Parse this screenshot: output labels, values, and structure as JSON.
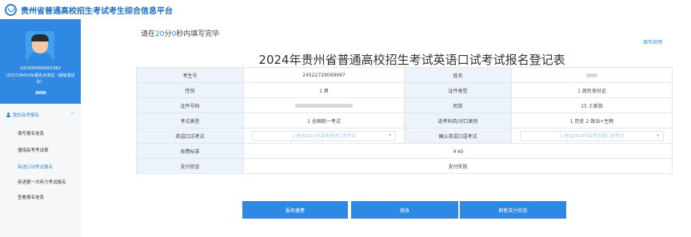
{
  "app": {
    "title": "贵州省普通高校招生考试考生综合信息平台",
    "logo_icon": "circle-logo-icon"
  },
  "sidebar": {
    "user_id": "2024000000001962",
    "user_desc": "(5227284109)报名点测试（首级测试办）",
    "menu_title": "我的高考报名",
    "menu_icon": "user-icon",
    "items": [
      {
        "label": "填写报名信息"
      },
      {
        "label": "僵饱高考考试费"
      },
      {
        "label": "英语口试考试报名"
      },
      {
        "label": "英语第一次听力考试报名"
      },
      {
        "label": "查看报名信息"
      }
    ],
    "active_index": 2
  },
  "timer": {
    "prefix": "请在",
    "minutes": "20",
    "min_unit": "分",
    "seconds": "0",
    "suffix": "秒内填写完毕"
  },
  "help_link": "填写说明",
  "form": {
    "title": "2024年贵州省普通高校招生考试英语口试考试报名登记表",
    "rows": [
      {
        "l1": "考生号",
        "v1": "24522729099997",
        "l2": "姓名",
        "v2": ""
      },
      {
        "l1": "性别",
        "v1": "1 男",
        "l2": "证件类型",
        "v2": "1 居民身份证"
      },
      {
        "l1": "证件号码",
        "v1": "",
        "l2": "民族",
        "v2": "15 土家族"
      },
      {
        "l1": "考试类型",
        "v1": "1 全国统一考试",
        "l2": "选考科目/对口类别",
        "v2": "1 历史 2 政治+生物"
      },
      {
        "l1": "英语口试考试",
        "v1": "1 参加2024年高考英语口语考试",
        "l2": "确认英语口语考试",
        "v2": "1 参加2024年高考英语口语考试"
      },
      {
        "l1": "收费标准",
        "v1": "￥40"
      },
      {
        "l1": "支付状态",
        "v1": "支付失败"
      }
    ]
  },
  "buttons": {
    "pay": "报名缴费",
    "edit": "修改",
    "refresh": "刷新支付状态"
  },
  "colors": {
    "primary": "#2f88e2",
    "label_bg": "#edf3fa"
  }
}
